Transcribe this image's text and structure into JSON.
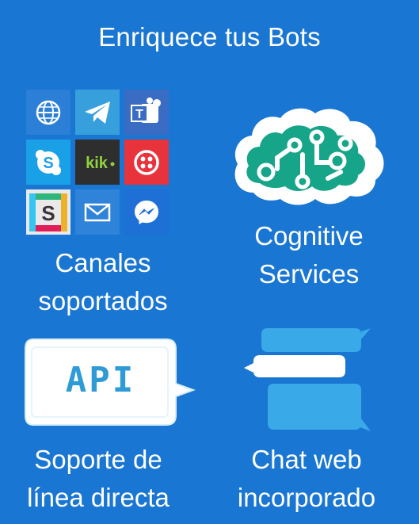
{
  "title": "Enriquece tus Bots",
  "sections": {
    "channels": {
      "line1": "Canales",
      "line2": "soportados",
      "icons": [
        "globe-icon",
        "telegram-icon",
        "teams-icon",
        "skype-icon",
        "kik-icon",
        "twilio-icon",
        "slack-icon",
        "email-icon",
        "messenger-icon"
      ]
    },
    "cognitive": {
      "line1": "Cognitive",
      "line2": "Services",
      "icon": "brain-circuit-icon"
    },
    "directline": {
      "line1": "Soporte de",
      "line2": "línea directa",
      "badge": "API"
    },
    "webchat": {
      "line1": "Chat web",
      "line2": "incorporado",
      "icon": "chat-bubbles-icon"
    }
  },
  "colors": {
    "background": "#1976d2",
    "accent": "#3aa9e8",
    "cognitive": "#17a589"
  }
}
